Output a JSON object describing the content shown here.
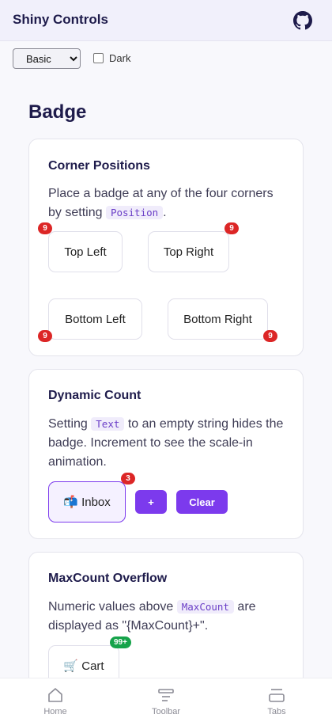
{
  "header": {
    "title": "Shiny Controls",
    "github_icon": "github-icon"
  },
  "controls": {
    "theme_options": [
      "Basic"
    ],
    "theme_selected": "Basic",
    "dark_label": "Dark",
    "dark_checked": false
  },
  "page": {
    "heading": "Badge"
  },
  "cards": {
    "corner": {
      "title": "Corner Positions",
      "desc_before": "Place a badge at any of the four corners by setting ",
      "code": "Position",
      "desc_after": ".",
      "buttons": [
        {
          "label": "Top Left",
          "badge": "9"
        },
        {
          "label": "Top Right",
          "badge": "9"
        },
        {
          "label": "Bottom Left",
          "badge": "9"
        },
        {
          "label": "Bottom Right",
          "badge": "9"
        }
      ]
    },
    "dynamic": {
      "title": "Dynamic Count",
      "desc_before": "Setting ",
      "code": "Text",
      "desc_after": " to an empty string hides the badge. Increment to see the scale-in animation.",
      "inbox_label": "📬 Inbox",
      "badge": "3",
      "plus_label": "+",
      "clear_label": "Clear"
    },
    "maxcount": {
      "title": "MaxCount Overflow",
      "desc_before": "Numeric values above ",
      "code": "MaxCount",
      "desc_after": " are displayed as \"{MaxCount}+\".",
      "cart_label": "🛒 Cart",
      "badge": "99+"
    }
  },
  "tabs": [
    {
      "label": "Home",
      "icon": "home-icon"
    },
    {
      "label": "Toolbar",
      "icon": "toolbar-icon"
    },
    {
      "label": "Tabs",
      "icon": "tabs-icon"
    }
  ],
  "colors": {
    "accent": "#7c3aed",
    "badge_red": "#dc2626",
    "badge_green": "#16a34a"
  }
}
